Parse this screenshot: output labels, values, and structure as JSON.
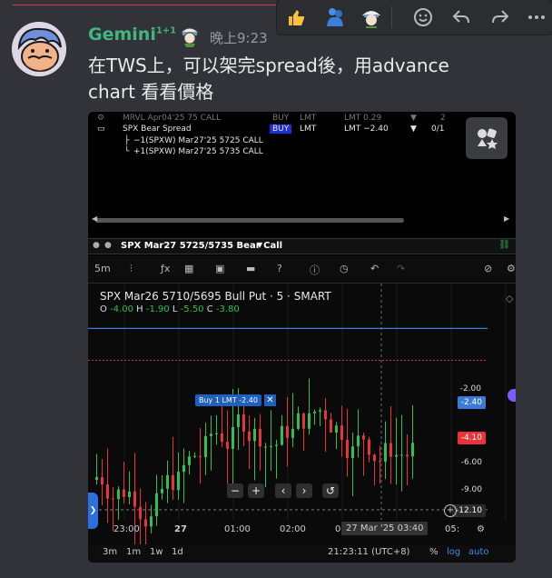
{
  "message": {
    "username": "Gemini",
    "username_sup": "1+1",
    "timestamp": "晚上9:23",
    "text_line1": "在TWS上，可以架完spread後，用advance",
    "text_line2": "chart 看看價格"
  },
  "toolbar": {
    "reactions": [
      "thumbs-up-icon",
      "people-hug-icon",
      "anime-avatar-icon"
    ],
    "actions": [
      "add-reaction-icon",
      "reply-icon",
      "forward-icon",
      "more-icon"
    ]
  },
  "orders": {
    "row0": {
      "label": "MRVL Apr04'25 75 CALL",
      "action": "BUY",
      "type": "LMT",
      "price": "LMT 0.29",
      "qty": "2"
    },
    "row1": {
      "label": "SPX Bear Spread",
      "action": "BUY",
      "type": "LMT",
      "price": "LMT −2.40",
      "qty": "0/1"
    },
    "leg1": "−1(SPXW) Mar27'25 5725 CALL",
    "leg2": "+1(SPXW) Mar27'25 5735 CALL"
  },
  "chart_header": {
    "title": "SPX Mar27 5725/5735 Bear Call"
  },
  "chart_toolbar": {
    "interval": "5m"
  },
  "chart_data": {
    "type": "candlestick",
    "title": "SPX Mar26 5710/5695 Bull Put · 5 · SMART",
    "ohlc": {
      "o_label": "O",
      "o": "-4.00",
      "h_label": "H",
      "h": "-1.90",
      "l_label": "L",
      "l": "-5.50",
      "c_label": "C",
      "c": "-3.80"
    },
    "y_ticks": [
      "-2.00",
      "-6.00",
      "-9.00"
    ],
    "price_labels": {
      "order": "-2.40",
      "last": "-4.10",
      "cursor": "-12.10"
    },
    "order_line": {
      "label": "Buy 1 LMT -2.40",
      "price": -2.4
    },
    "x_ticks": [
      "23:00",
      "27",
      "01:00",
      "02:00",
      "03",
      "03:40",
      "05:"
    ],
    "crosshair_label": "27 Mar '25",
    "ylim": [
      -14,
      0
    ]
  },
  "bottom": {
    "ranges": [
      "3m",
      "1m",
      "1w",
      "1d"
    ],
    "clock": "21:23:11 (UTC+8)",
    "pct": "%",
    "log": "log",
    "auto": "auto"
  },
  "colors": {
    "up": "#2fbf52",
    "down": "#e8333b",
    "order_line": "#3a7bd5",
    "username": "#43b581"
  }
}
